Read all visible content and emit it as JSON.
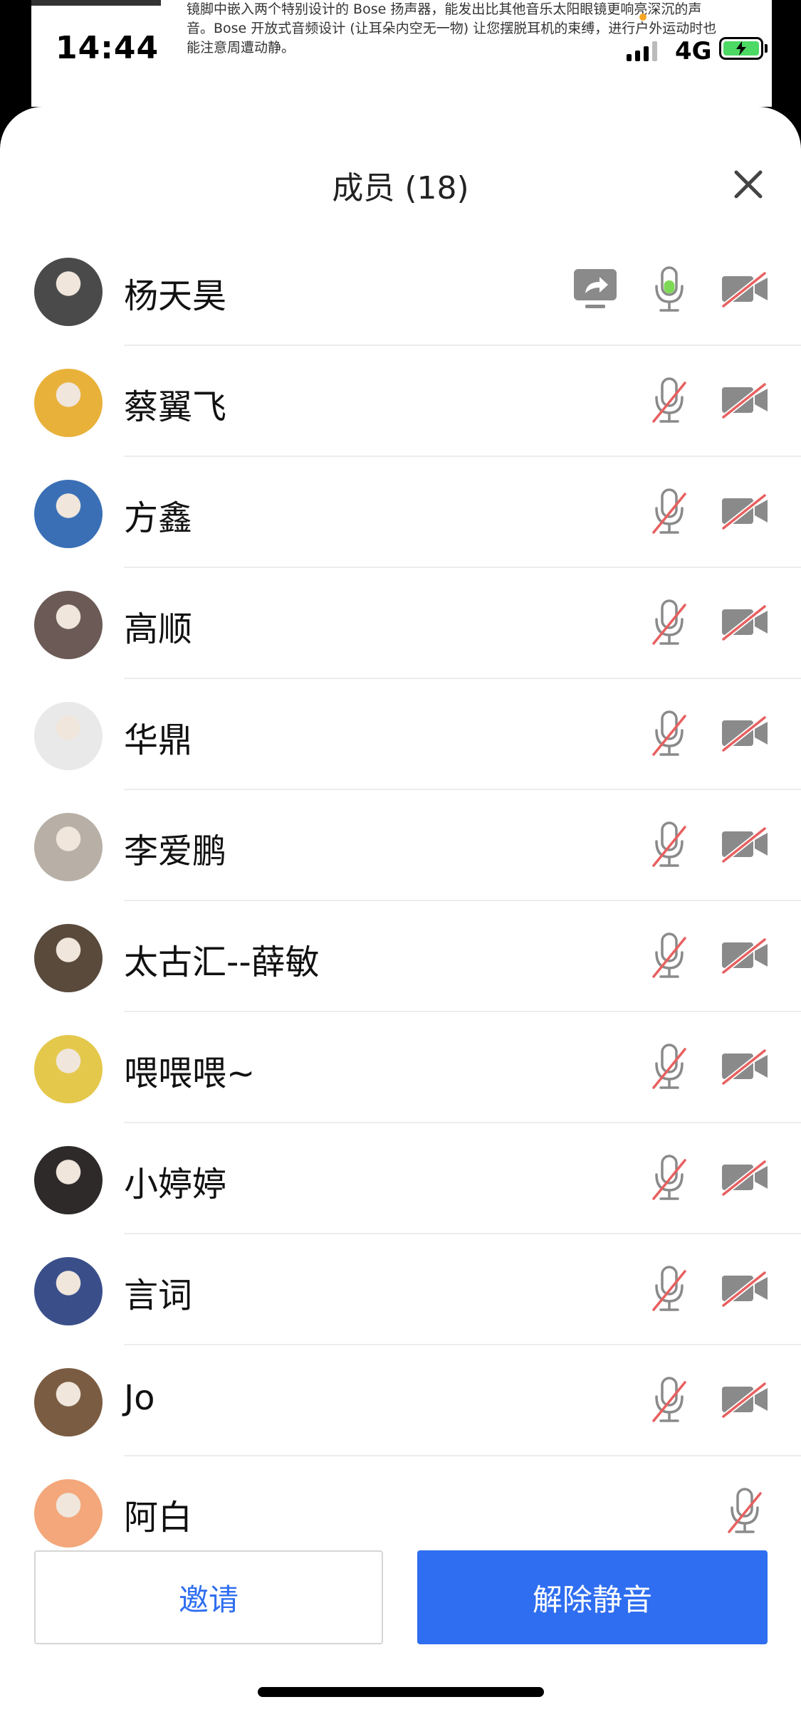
{
  "background": {
    "article_text": "镜脚中嵌入两个特别设计的 Bose 扬声器，能发出比其他音乐太阳眼镜更响亮深沉的声音。Bose 开放式音频设计 (让耳朵内空无一物) 让您摆脱耳机的束缚，进行户外运动时也能注意周遭动静。"
  },
  "status_bar": {
    "time": "14:44",
    "network": "4G",
    "battery_icon": "battery-charging-icon"
  },
  "sheet": {
    "title": "成员 (18)",
    "close_icon": "close-icon"
  },
  "members": [
    {
      "name": "杨天昊",
      "sharing": true,
      "mic": "active",
      "camera": "off",
      "avatar_color": "#4a4a4a"
    },
    {
      "name": "蔡翼飞",
      "mic": "muted",
      "camera": "off",
      "avatar_color": "#e8b13a"
    },
    {
      "name": "方鑫",
      "mic": "muted",
      "camera": "off",
      "avatar_color": "#3a6fb5"
    },
    {
      "name": "高顺",
      "mic": "muted",
      "camera": "off",
      "avatar_color": "#6b5a55"
    },
    {
      "name": "华鼎",
      "mic": "muted",
      "camera": "off",
      "avatar_color": "#e9e9e9"
    },
    {
      "name": "李爱鹏",
      "mic": "muted",
      "camera": "off",
      "avatar_color": "#b8b0a6"
    },
    {
      "name": "太古汇--薛敏",
      "mic": "muted",
      "camera": "off",
      "avatar_color": "#5a4a3c"
    },
    {
      "name": "喂喂喂~",
      "mic": "muted",
      "camera": "off",
      "avatar_color": "#e4c84c"
    },
    {
      "name": "小婷婷",
      "mic": "muted",
      "camera": "off",
      "avatar_color": "#2e2a2a"
    },
    {
      "name": "言词",
      "mic": "muted",
      "camera": "off",
      "avatar_color": "#3a4f8a"
    },
    {
      "name": "Jo",
      "mic": "muted",
      "camera": "off",
      "avatar_color": "#7a5c42"
    },
    {
      "name": "阿白",
      "mic": "muted",
      "camera": "none",
      "avatar_color": "#f3a77a"
    }
  ],
  "buttons": {
    "invite": "邀请",
    "unmute": "解除静音"
  },
  "colors": {
    "accent": "#2f6ef0",
    "mic_active": "#7ed957",
    "muted_slash": "#e86060",
    "icon_gray": "#8a8a8a"
  }
}
